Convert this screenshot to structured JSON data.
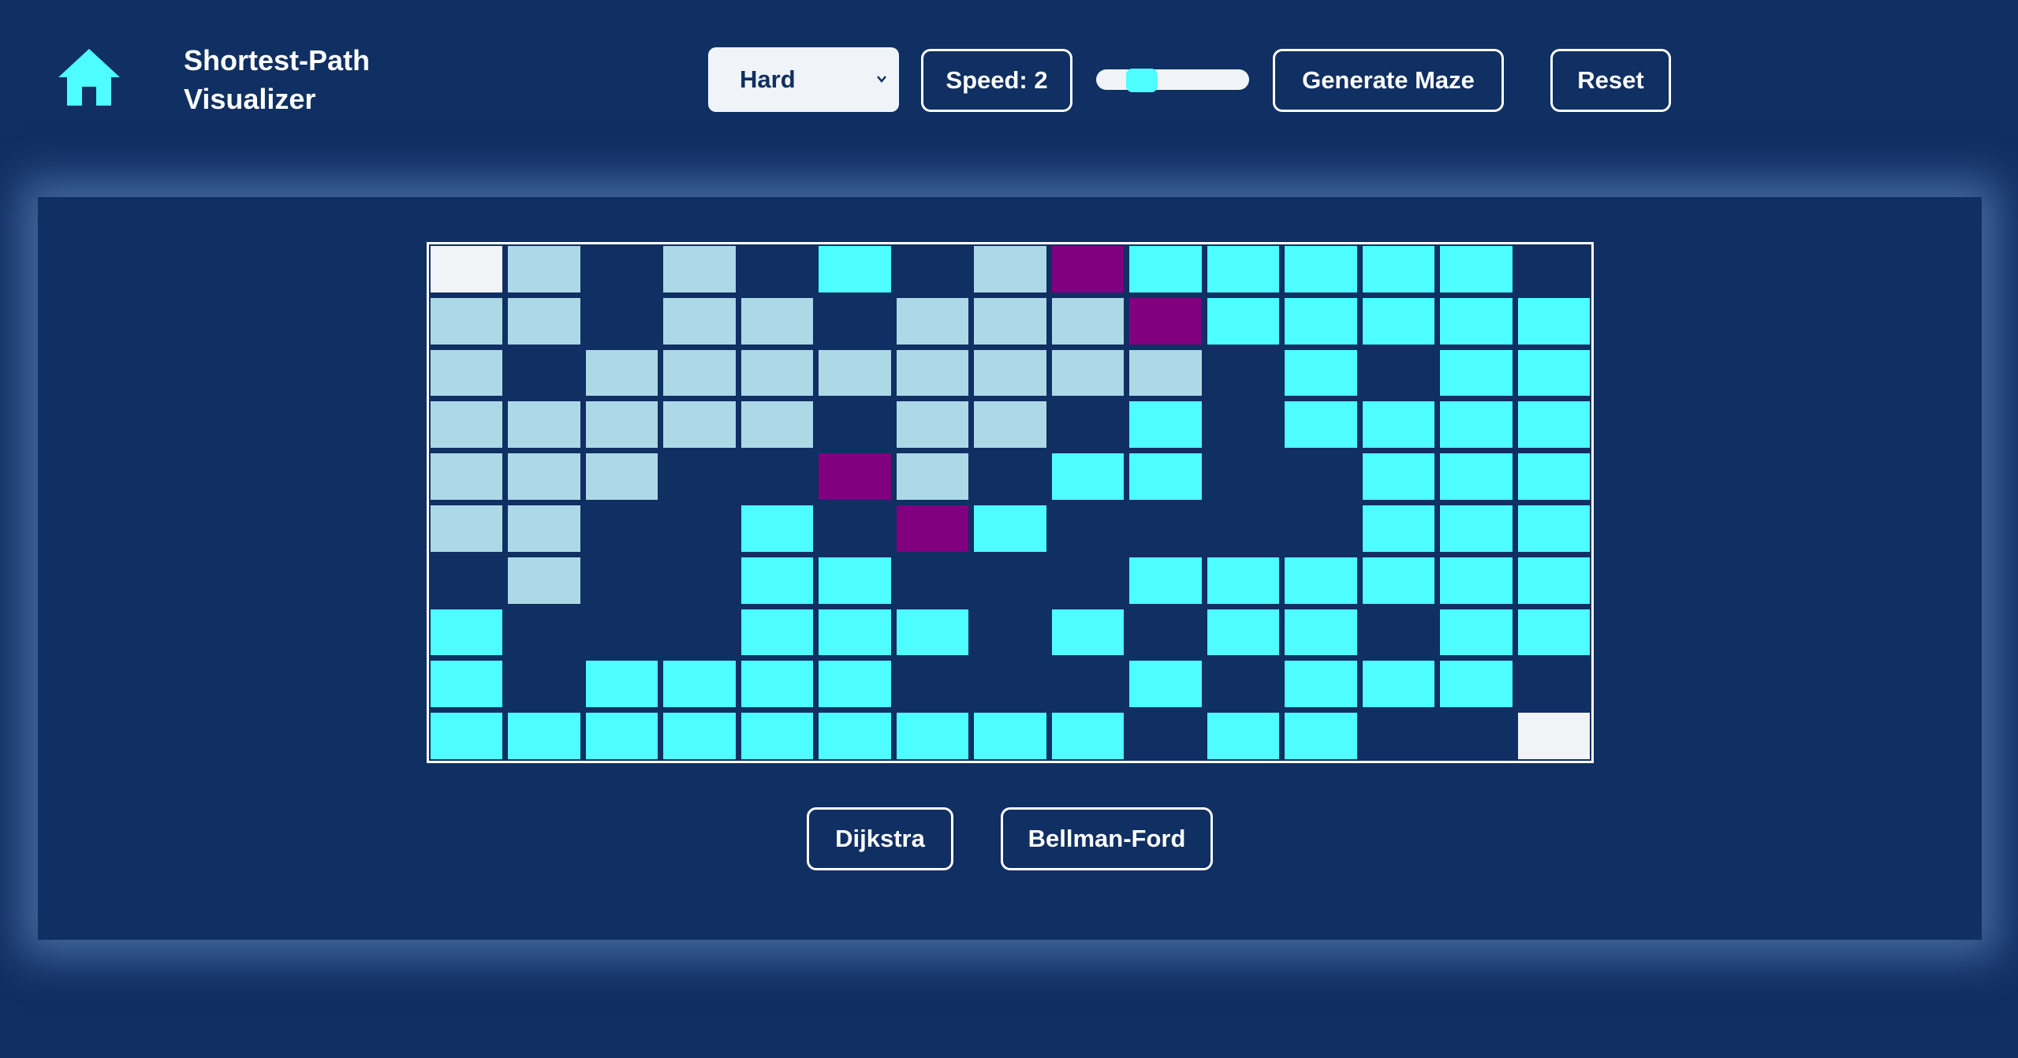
{
  "header": {
    "home_icon": "home-icon",
    "title_line1": "Shortest-Path",
    "title_line2": "Visualizer",
    "difficulty": {
      "selected": "Hard",
      "icon": "chevron-down-icon"
    },
    "speed_label": "Speed: 2",
    "speed_slider_fraction": 0.3,
    "generate_label": "Generate Maze",
    "reset_label": "Reset"
  },
  "grid": {
    "rows": 10,
    "cols": 15,
    "legend": {
      "W": "empty",
      "V": "visited",
      "C": "frontier",
      "P": "path",
      "E": "endpoint"
    },
    "cells": [
      "EVWVWCWVPCCCCCW",
      "VVWVVWVVVPCCCCC",
      "VWVVVVVVVVWCWCC",
      "VVVVVWVVWCWCCCC",
      "VVVWWPVWCCWWCCC",
      "VVWWCWPCWWWWCCC",
      "WVWWCCWWWCCCCCC",
      "CWWWCCCWCWCCWCC",
      "CWCCCCWWWCWCCCW",
      "CCCCCCCCCWCCWWE"
    ]
  },
  "algorithms": {
    "dijkstra_label": "Dijkstra",
    "bellman_ford_label": "Bellman-Ford"
  },
  "colors": {
    "background": "#102f62",
    "visited": "#add8e6",
    "frontier": "#4dfdff",
    "path": "#800080",
    "endpoint": "#f1f3f7",
    "accent": "#4dfdff"
  }
}
